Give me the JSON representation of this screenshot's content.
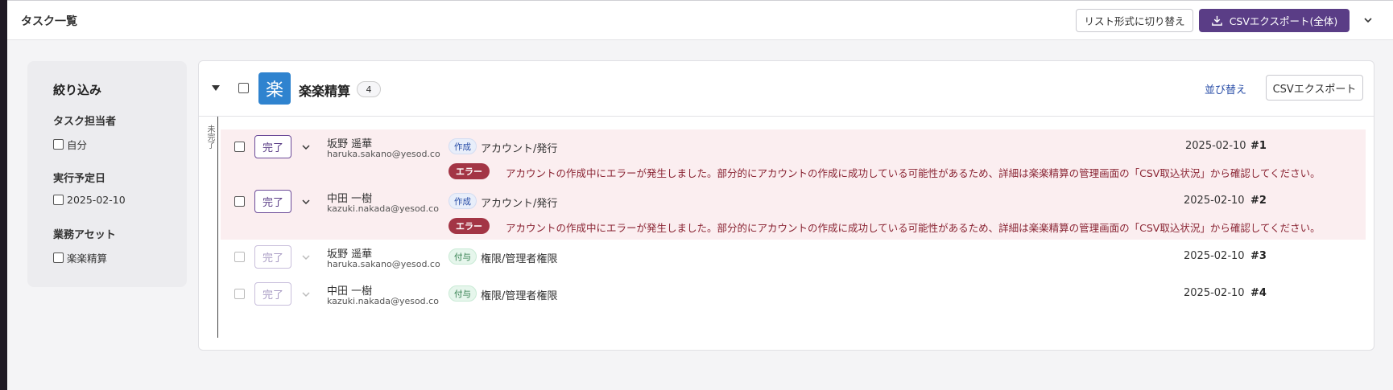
{
  "header": {
    "title": "タスク一覧",
    "list_view_label": "リスト形式に切り替え",
    "csv_export_all_label": "CSVエクスポート(全体)"
  },
  "filter": {
    "title": "絞り込み",
    "assignee": {
      "heading": "タスク担当者",
      "option": "自分"
    },
    "date": {
      "heading": "実行予定日",
      "option": "2025-02-10"
    },
    "asset": {
      "heading": "業務アセット",
      "option": "楽楽精算"
    }
  },
  "group": {
    "logo_char": "楽",
    "name": "楽楽精算",
    "count": "4",
    "sort_label": "並び替え",
    "csv_export_label": "CSVエクスポート",
    "status_label": "未完了"
  },
  "rows": [
    {
      "done_label": "完了",
      "name": "坂野 遥華",
      "email": "haruka.sakano@yesod.co",
      "tag": "作成",
      "task": "アカウント/発行",
      "date": "2025-02-10",
      "number": "#1",
      "error_badge": "エラー",
      "error_message": "アカウントの作成中にエラーが発生しました。部分的にアカウントの作成に成功している可能性があるため、詳細は楽楽精算の管理画面の「CSV取込状況」から確認してください。"
    },
    {
      "done_label": "完了",
      "name": "中田 一樹",
      "email": "kazuki.nakada@yesod.co",
      "tag": "作成",
      "task": "アカウント/発行",
      "date": "2025-02-10",
      "number": "#2",
      "error_badge": "エラー",
      "error_message": "アカウントの作成中にエラーが発生しました。部分的にアカウントの作成に成功している可能性があるため、詳細は楽楽精算の管理画面の「CSV取込状況」から確認してください。"
    },
    {
      "done_label": "完了",
      "name": "坂野 遥華",
      "email": "haruka.sakano@yesod.co",
      "tag": "付与",
      "task": "権限/管理者権限",
      "date": "2025-02-10",
      "number": "#3"
    },
    {
      "done_label": "完了",
      "name": "中田 一樹",
      "email": "kazuki.nakada@yesod.co",
      "tag": "付与",
      "task": "権限/管理者権限",
      "date": "2025-02-10",
      "number": "#4"
    }
  ],
  "colors": {
    "primary": "#5a3d86",
    "error": "#a33545",
    "error_bg": "#fbeef0",
    "logo": "#2f83cf"
  }
}
